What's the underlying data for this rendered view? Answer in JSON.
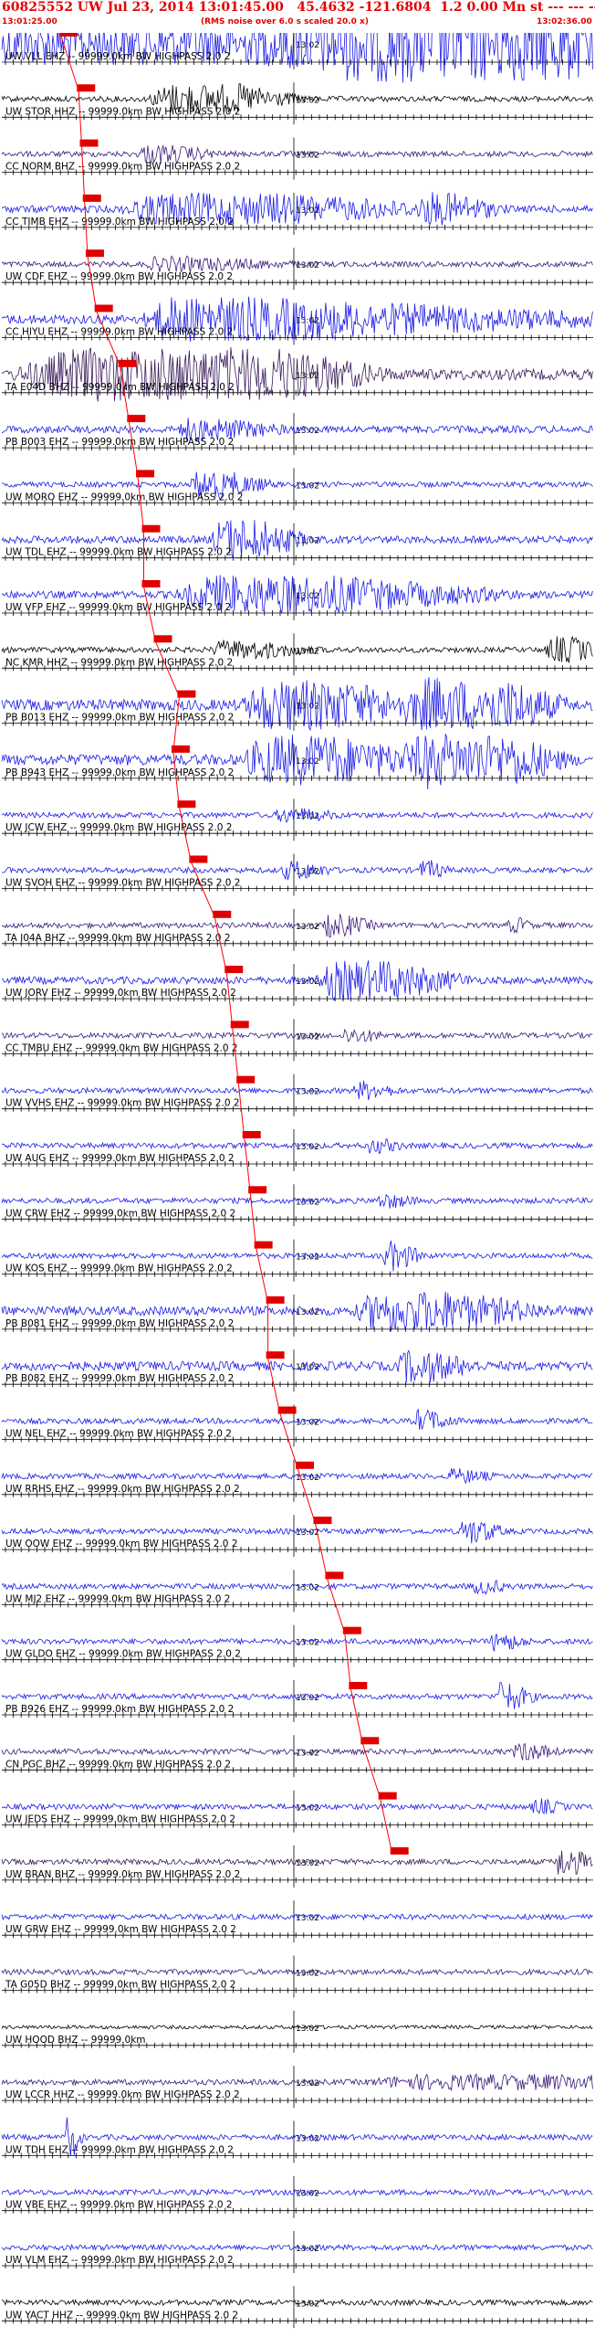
{
  "header": {
    "title": "60825552 UW Jul 23, 2014 13:01:45.00   45.4632 -121.6804  1.2 0.00 Mn st --- --- --  -1",
    "start_time": "13:01:25.00",
    "note": "(RMS noise over 6.0 s scaled 20.0 x)",
    "end_time": "13:02:36.00"
  },
  "time_mark": "13:02",
  "colors": {
    "header": "#e00000",
    "pick": "#ff0000",
    "minute_line": "#000000"
  },
  "traces": [
    {
      "label": "UW VLL EHZ -- 99999.0km BW HIGHPASS  2.0  2",
      "color": "#1a1ae6",
      "amp": 5,
      "events": [
        [
          3,
          90,
          0.6,
          18
        ],
        [
          60,
          0.55,
          0.15,
          20
        ]
      ]
    },
    {
      "label": "UW STOR HHZ -- 99999.0km BW HIGHPASS  2.0  2",
      "color": "#000000",
      "amp": 3,
      "events": [
        [
          0.28,
          0.12,
          0.12,
          14
        ]
      ]
    },
    {
      "label": "CC NORM BHZ -- 99999.0km BW HIGHPASS  2.0  2",
      "color": "#3a1a7a",
      "amp": 3,
      "events": [
        [
          0.24,
          0.04,
          0.1,
          8
        ]
      ]
    },
    {
      "label": "CC TIMB EHZ -- 99999.0km BW HIGHPASS  2.0  2",
      "color": "#1a1ae6",
      "amp": 4,
      "events": [
        [
          0.26,
          0.2,
          0.35,
          14
        ],
        [
          0.72,
          0.06,
          0.08,
          12
        ]
      ]
    },
    {
      "label": "UW CDF EHZ -- 99999.0km BW HIGHPASS  2.0  2",
      "color": "#3a1a7a",
      "amp": 3,
      "events": [
        [
          0.26,
          0.06,
          0.2,
          6
        ]
      ]
    },
    {
      "label": "CC HIYU EHZ -- 99999.0km BW HIGHPASS  2.0  2",
      "color": "#1a1ae6",
      "amp": 5,
      "events": [
        [
          0.28,
          0.15,
          0.7,
          20
        ]
      ]
    },
    {
      "label": "TA E04D BHZ -- 99999.0km BW HIGHPASS  2.0  2",
      "color": "#3a1a5a",
      "amp": 6,
      "events": [
        [
          0.12,
          0.35,
          0.2,
          24
        ]
      ]
    },
    {
      "label": "PB B003 EHZ -- 99999.0km BW HIGHPASS  2.0  2",
      "color": "#1a1ae6",
      "amp": 4,
      "events": [
        [
          0.31,
          0.04,
          0.15,
          10
        ]
      ]
    },
    {
      "label": "UW MORO EHZ -- 99999.0km BW HIGHPASS  2.0  2",
      "color": "#1a1ae6",
      "amp": 3,
      "events": [
        [
          0.33,
          0.04,
          0.1,
          14
        ]
      ]
    },
    {
      "label": "UW TDL EHZ -- 99999.0km BW HIGHPASS  2.0  2",
      "color": "#1a1ae6",
      "amp": 4,
      "events": [
        [
          0.37,
          0.06,
          0.1,
          20
        ]
      ]
    },
    {
      "label": "UW VFP EHZ -- 99999.0km BW HIGHPASS  2.0  2",
      "color": "#1a1ae6",
      "amp": 4,
      "events": [
        [
          0.35,
          0.2,
          0.35,
          18
        ]
      ]
    },
    {
      "label": "NC KMR HHZ -- 99999.0km BW HIGHPASS  2.0  2",
      "color": "#000000",
      "amp": 3,
      "events": [
        [
          0.37,
          0.06,
          0.12,
          8
        ],
        [
          0.93,
          0.04,
          0.05,
          12
        ]
      ]
    },
    {
      "label": "PB B013 EHZ -- 99999.0km BW HIGHPASS  2.0  2",
      "color": "#1a1ae6",
      "amp": 6,
      "events": [
        [
          0.44,
          0.12,
          0.2,
          22
        ],
        [
          0.72,
          0.15,
          0.1,
          22
        ]
      ]
    },
    {
      "label": "PB B943 EHZ -- 99999.0km BW HIGHPASS  2.0  2",
      "color": "#1a1ae6",
      "amp": 6,
      "events": [
        [
          0.44,
          0.12,
          0.2,
          22
        ],
        [
          0.72,
          0.15,
          0.1,
          22
        ]
      ]
    },
    {
      "label": "UW JCW EHZ -- 99999.0km BW HIGHPASS  2.0  2",
      "color": "#1a1ae6",
      "amp": 3,
      "events": [
        [
          0.47,
          0.03,
          0.08,
          6
        ]
      ]
    },
    {
      "label": "UW SVOH EHZ -- 99999.0km BW HIGHPASS  2.0  2",
      "color": "#1a1ae6",
      "amp": 3,
      "events": [
        [
          0.48,
          0.03,
          0.06,
          8
        ],
        [
          0.71,
          0.02,
          0.03,
          8
        ]
      ]
    },
    {
      "label": "TA I04A BHZ -- 99999.0km BW HIGHPASS  2.0  2",
      "color": "#3a1a7a",
      "amp": 3,
      "events": [
        [
          0.55,
          0.03,
          0.06,
          10
        ],
        [
          0.86,
          0.02,
          0.02,
          6
        ]
      ]
    },
    {
      "label": "UW JORV EHZ -- 99999.0km BW HIGHPASS  2.0  2",
      "color": "#1a1ae6",
      "amp": 4,
      "events": [
        [
          0.56,
          0.1,
          0.15,
          18
        ]
      ]
    },
    {
      "label": "CC TMBU EHZ -- 99999.0km BW HIGHPASS  2.0  2",
      "color": "#3a1a7a",
      "amp": 3,
      "events": [
        [
          0.58,
          0.02,
          0.06,
          6
        ]
      ]
    },
    {
      "label": "UW VVHS EHZ -- 99999.0km BW HIGHPASS  2.0  2",
      "color": "#1a1ae6",
      "amp": 3,
      "events": [
        [
          0.6,
          0.02,
          0.06,
          8
        ]
      ]
    },
    {
      "label": "UW AUG EHZ -- 99999.0km BW HIGHPASS  2.0  2",
      "color": "#1a1ae6",
      "amp": 3,
      "events": [
        [
          0.62,
          0.02,
          0.05,
          6
        ]
      ]
    },
    {
      "label": "UW CRW EHZ -- 99999.0km BW HIGHPASS  2.0  2",
      "color": "#1a1ae6",
      "amp": 3,
      "events": [
        [
          0.64,
          0.02,
          0.05,
          6
        ]
      ]
    },
    {
      "label": "UW KOS EHZ -- 99999.0km BW HIGHPASS  2.0  2",
      "color": "#1a1ae6",
      "amp": 3,
      "events": [
        [
          0.65,
          0.02,
          0.05,
          14
        ]
      ]
    },
    {
      "label": "PB B081 EHZ -- 99999.0km BW HIGHPASS  2.0  2",
      "color": "#1a1ae6",
      "amp": 5,
      "events": [
        [
          0.63,
          0.12,
          0.2,
          18
        ]
      ]
    },
    {
      "label": "PB B082 EHZ -- 99999.0km BW HIGHPASS  2.0  2",
      "color": "#1a1ae6",
      "amp": 5,
      "events": [
        [
          0.68,
          0.04,
          0.1,
          14
        ]
      ]
    },
    {
      "label": "UW NEL EHZ -- 99999.0km BW HIGHPASS  2.0  2",
      "color": "#1a1ae6",
      "amp": 3,
      "events": [
        [
          0.7,
          0.02,
          0.06,
          10
        ]
      ]
    },
    {
      "label": "UW RRHS EHZ -- 99999.0km BW HIGHPASS  2.0  2",
      "color": "#1a1ae6",
      "amp": 3,
      "events": [
        [
          0.76,
          0.02,
          0.06,
          6
        ]
      ]
    },
    {
      "label": "UW OOW EHZ -- 99999.0km BW HIGHPASS  2.0  2",
      "color": "#1a1ae6",
      "amp": 3,
      "events": [
        [
          0.78,
          0.02,
          0.06,
          12
        ]
      ]
    },
    {
      "label": "UW MJ2 EHZ -- 99999.0km BW HIGHPASS  2.0  2",
      "color": "#1a1ae6",
      "amp": 3,
      "events": [
        [
          0.8,
          0.02,
          0.05,
          6
        ]
      ]
    },
    {
      "label": "UW GLDO EHZ -- 99999.0km BW HIGHPASS  2.0  2",
      "color": "#1a1ae6",
      "amp": 3,
      "events": [
        [
          0.83,
          0.02,
          0.05,
          8
        ]
      ]
    },
    {
      "label": "PB B926 EHZ -- 99999.0km BW HIGHPASS  2.0  2",
      "color": "#1a1ae6",
      "amp": 3,
      "events": [
        [
          0.84,
          0.02,
          0.05,
          14
        ]
      ]
    },
    {
      "label": "CN PGC BHZ -- 99999.0km BW HIGHPASS  2.0  2",
      "color": "#3a1a7a",
      "amp": 3,
      "events": [
        [
          0.87,
          0.02,
          0.06,
          8
        ]
      ]
    },
    {
      "label": "UW JEDS EHZ -- 99999.0km BW HIGHPASS  2.0  2",
      "color": "#1a1ae6",
      "amp": 3,
      "events": [
        [
          0.9,
          0.02,
          0.04,
          6
        ]
      ]
    },
    {
      "label": "UW BRAN BHZ -- 99999.0km BW HIGHPASS  2.0  2",
      "color": "#3a1a5a",
      "amp": 3,
      "events": [
        [
          0.94,
          0.02,
          0.05,
          14
        ]
      ]
    },
    {
      "label": "UW GRW EHZ -- 99999.0km BW HIGHPASS  2.0  2",
      "color": "#1a1ae6",
      "amp": 3,
      "events": []
    },
    {
      "label": "TA G05D BHZ -- 99999.0km BW HIGHPASS  2.0  2",
      "color": "#3a1a7a",
      "amp": 3,
      "events": []
    },
    {
      "label": "UW HOOD BHZ -- 99999.0km",
      "color": "#000000",
      "amp": 2,
      "events": []
    },
    {
      "label": "UW LCCR HHZ -- 99999.0km BW HIGHPASS  2.0  2",
      "color": "#3a1a7a",
      "amp": 3,
      "events": [
        [
          0.7,
          0.3,
          0.2,
          6
        ]
      ]
    },
    {
      "label": "UW TDH EHZ -- 99999.0km BW HIGHPASS  2.0  2",
      "color": "#1a1ae6",
      "amp": 3,
      "events": [
        [
          0.11,
          0.01,
          0.02,
          20
        ]
      ]
    },
    {
      "label": "UW VBE EHZ -- 99999.0km BW HIGHPASS  2.0  2",
      "color": "#1a1ae6",
      "amp": 3,
      "events": []
    },
    {
      "label": "UW VLM EHZ -- 99999.0km BW HIGHPASS  2.0  2",
      "color": "#1a1ae6",
      "amp": 3,
      "events": []
    },
    {
      "label": "UW YACT HHZ -- 99999.0km BW HIGHPASS  2.0  2",
      "color": "#000000",
      "amp": 3,
      "events": []
    }
  ],
  "picks": [
    0.1,
    0.13,
    0.135,
    0.14,
    0.145,
    0.16,
    0.2,
    0.215,
    0.23,
    0.24,
    0.24,
    0.26,
    0.3,
    0.29,
    0.3,
    0.32,
    0.36,
    0.38,
    0.39,
    0.4,
    0.41,
    0.42,
    0.43,
    0.45,
    0.45,
    0.47,
    0.5,
    0.53,
    0.55,
    0.58,
    0.59,
    0.61,
    0.64,
    0.66
  ]
}
